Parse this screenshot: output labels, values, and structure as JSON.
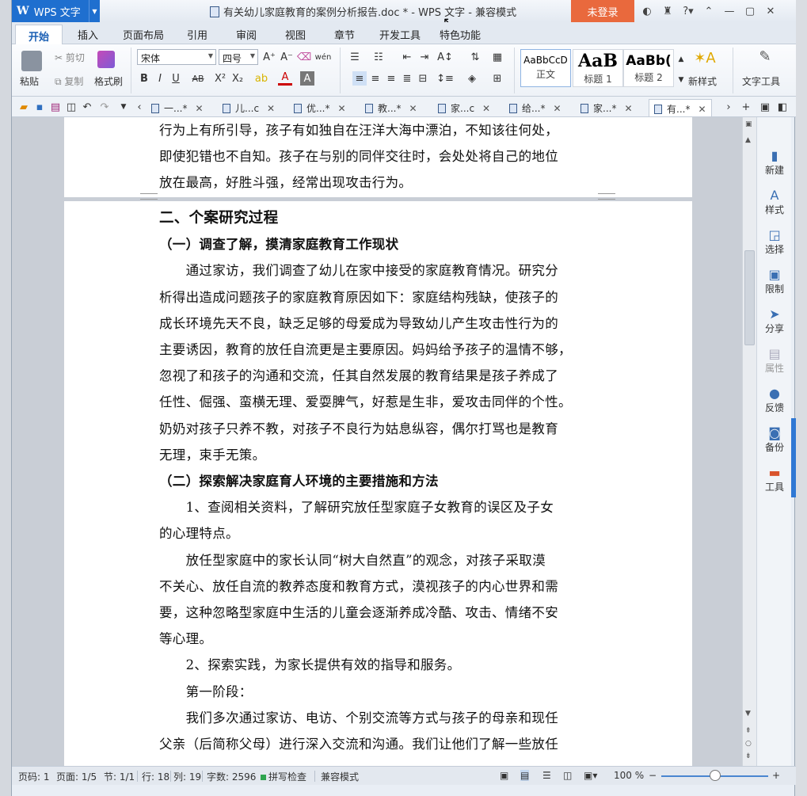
{
  "titlebar": {
    "app_name": "WPS 文字",
    "title": "有关幼儿家庭教育的案例分析报告.doc * - WPS 文字 - 兼容模式",
    "login": "未登录"
  },
  "menu": {
    "tabs": [
      "开始",
      "插入",
      "页面布局",
      "引用",
      "审阅",
      "视图",
      "章节",
      "开发工具",
      "特色功能"
    ]
  },
  "ribbon": {
    "paste": "粘贴",
    "cut": "剪切",
    "copy": "复制",
    "format_painter": "格式刷",
    "font_name": "宋体",
    "font_size": "四号",
    "styles": [
      {
        "sample": "AaBbCcD",
        "label": "正文"
      },
      {
        "sample": "AaB",
        "label": "标题 1"
      },
      {
        "sample": "AaBb(",
        "label": "标题 2"
      }
    ],
    "new_style": "新样式",
    "text_tools": "文字工具"
  },
  "doc_tabs": [
    {
      "label": "一...*",
      "active": false
    },
    {
      "label": "儿...c",
      "active": false
    },
    {
      "label": "优...*",
      "active": false
    },
    {
      "label": "教...*",
      "active": false
    },
    {
      "label": "家...c",
      "active": false
    },
    {
      "label": "给...*",
      "active": false
    },
    {
      "label": "家...*",
      "active": false
    },
    {
      "label": "有...*",
      "active": true
    }
  ],
  "document": {
    "page1_lines": [
      "行为上有所引导，孩子有如独自在汪洋大海中漂泊，不知该往何处，",
      "即使犯错也不自知。孩子在与别的同伴交往时，会处处将自己的地位",
      "放在最高，好胜斗强，经常出现攻击行为。"
    ],
    "heading": "二、个案研究过程",
    "sub1": "（一）调查了解，摸清家庭教育工作现状",
    "para1": [
      "　　通过家访，我们调查了幼儿在家中接受的家庭教育情况。研究分",
      "析得出造成问题孩子的家庭教育原因如下：家庭结构残缺，使孩子的",
      "成长环境先天不良，缺乏足够的母爱成为导致幼儿产生攻击性行为的",
      "主要诱因，教育的放任自流更是主要原因。妈妈给予孩子的温情不够，",
      "忽视了和孩子的沟通和交流，任其自然发展的教育结果是孩子养成了",
      "任性、倔强、蛮横无理、爱耍脾气，好惹是生非，爱攻击同伴的个性。",
      "奶奶对孩子只养不教，对孩子不良行为姑息纵容，偶尔打骂也是教育",
      "无理，束手无策。"
    ],
    "sub2": "（二）探索解决家庭育人环境的主要措施和方法",
    "para2": [
      "　　1、查阅相关资料，了解研究放任型家庭子女教育的误区及子女",
      "的心理特点。",
      "　　放任型家庭中的家长认同“树大自然直”的观念，对孩子采取漠",
      "不关心、放任自流的教养态度和教育方式，漠视孩子的内心世界和需",
      "要，这种忽略型家庭中生活的儿童会逐渐养成冷酷、攻击、情绪不安",
      "等心理。",
      "　　2、探索实践，为家长提供有效的指导和服务。",
      "　　第一阶段：",
      "　　我们多次通过家访、电访、个别交流等方式与孩子的母亲和现任",
      "父亲（后简称父母）进行深入交流和沟通。我们让他们了解一些放任"
    ]
  },
  "side_panel": [
    {
      "label": "新建",
      "icon": "new-doc-icon",
      "glyph": "▮",
      "disabled": false
    },
    {
      "label": "样式",
      "icon": "style-icon",
      "glyph": "A",
      "disabled": false
    },
    {
      "label": "选择",
      "icon": "select-icon",
      "glyph": "◲",
      "disabled": false
    },
    {
      "label": "限制",
      "icon": "restrict-icon",
      "glyph": "▣",
      "disabled": false
    },
    {
      "label": "分享",
      "icon": "share-icon",
      "glyph": "➤",
      "disabled": false
    },
    {
      "label": "属性",
      "icon": "properties-icon",
      "glyph": "▤",
      "disabled": true
    },
    {
      "label": "反馈",
      "icon": "feedback-icon",
      "glyph": "●",
      "disabled": false
    },
    {
      "label": "备份",
      "icon": "backup-icon",
      "glyph": "◙",
      "disabled": false
    },
    {
      "label": "工具",
      "icon": "toolbox-icon",
      "glyph": "▬",
      "disabled": false
    }
  ],
  "status": {
    "page_num": "页码: 1",
    "pages": "页面: 1/5",
    "section": "节: 1/1",
    "row": "行: 18",
    "col": "列: 19",
    "word_count": "字数: 2596",
    "spell_check": "拼写检查",
    "compat_mode": "兼容模式",
    "zoom": "100 %"
  },
  "colors": {
    "accent": "#1f6fcf",
    "login_bg": "#e9693d",
    "spell_ok": "#2ea44f"
  }
}
